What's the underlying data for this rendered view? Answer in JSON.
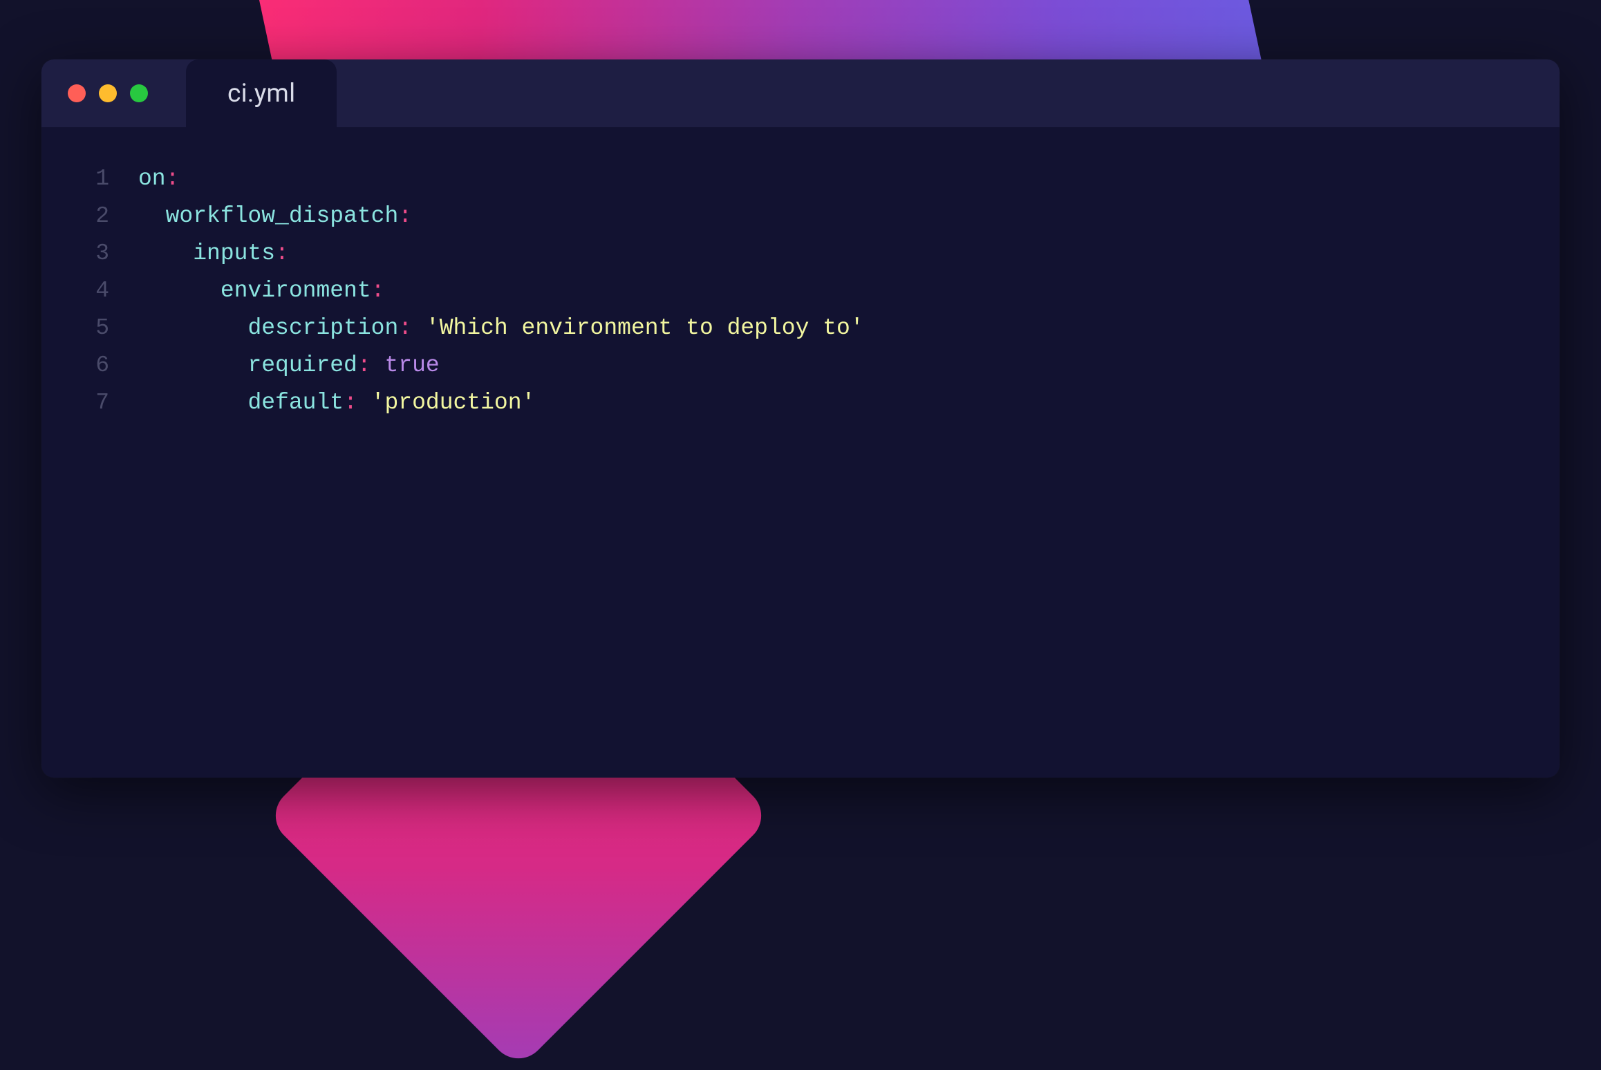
{
  "tab": {
    "filename": "ci.yml"
  },
  "traffic_lights": {
    "close": "#ff5f57",
    "minimize": "#febc2e",
    "zoom": "#28c840"
  },
  "code": {
    "indent_unit": "  ",
    "lines": [
      {
        "num": 1,
        "indent": 0,
        "tokens": [
          {
            "t": "key",
            "v": "on"
          },
          {
            "t": "colon",
            "v": ":"
          }
        ]
      },
      {
        "num": 2,
        "indent": 1,
        "tokens": [
          {
            "t": "key",
            "v": "workflow_dispatch"
          },
          {
            "t": "colon",
            "v": ":"
          }
        ]
      },
      {
        "num": 3,
        "indent": 2,
        "tokens": [
          {
            "t": "key",
            "v": "inputs"
          },
          {
            "t": "colon",
            "v": ":"
          }
        ]
      },
      {
        "num": 4,
        "indent": 3,
        "tokens": [
          {
            "t": "key",
            "v": "environment"
          },
          {
            "t": "colon",
            "v": ":"
          }
        ]
      },
      {
        "num": 5,
        "indent": 4,
        "tokens": [
          {
            "t": "key",
            "v": "description"
          },
          {
            "t": "colon",
            "v": ":"
          },
          {
            "t": "plain",
            "v": " "
          },
          {
            "t": "str",
            "v": "'Which environment to deploy to'"
          }
        ]
      },
      {
        "num": 6,
        "indent": 4,
        "tokens": [
          {
            "t": "key",
            "v": "required"
          },
          {
            "t": "colon",
            "v": ":"
          },
          {
            "t": "plain",
            "v": " "
          },
          {
            "t": "const",
            "v": "true"
          }
        ]
      },
      {
        "num": 7,
        "indent": 4,
        "tokens": [
          {
            "t": "key",
            "v": "default"
          },
          {
            "t": "colon",
            "v": ":"
          },
          {
            "t": "plain",
            "v": " "
          },
          {
            "t": "str",
            "v": "'production'"
          }
        ]
      }
    ]
  }
}
